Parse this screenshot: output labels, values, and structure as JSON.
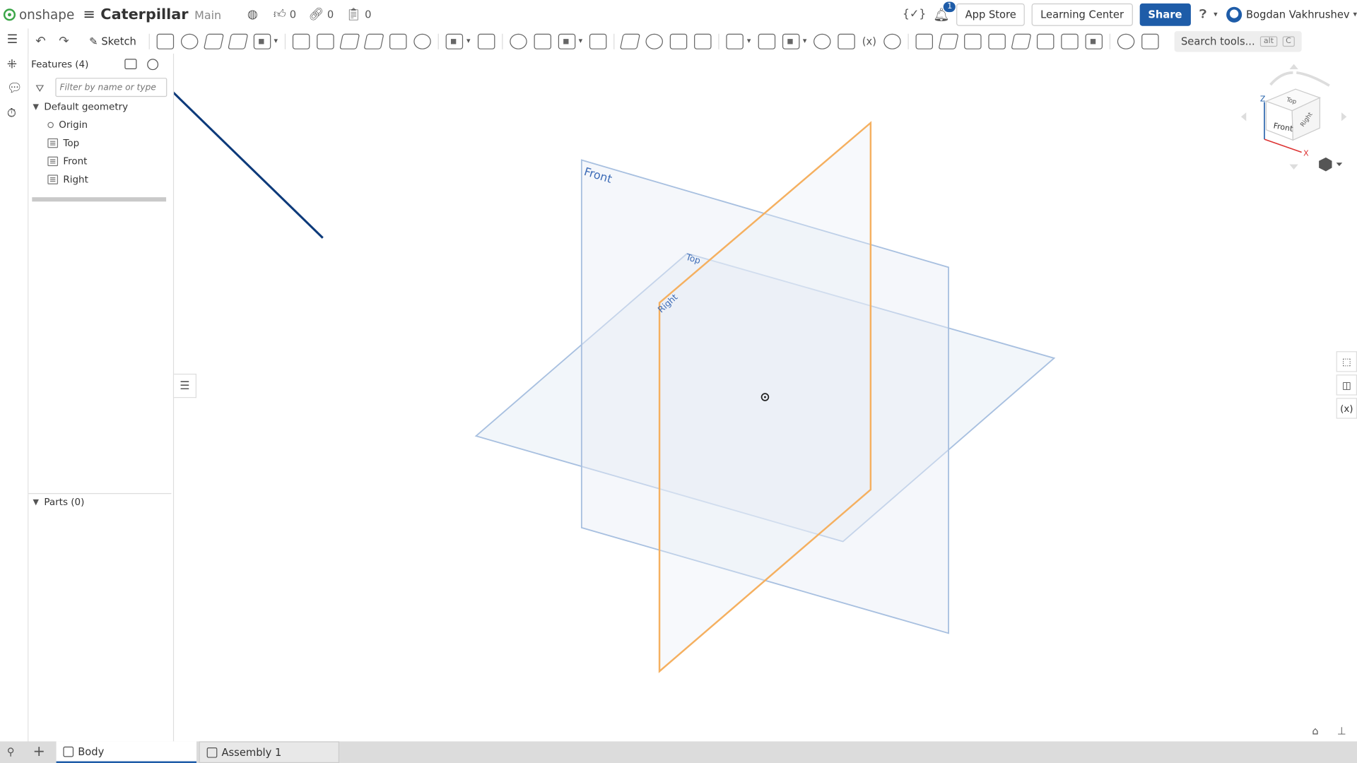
{
  "app": {
    "name": "onshape"
  },
  "document": {
    "title": "Caterpillar",
    "branch": "Main"
  },
  "topbar": {
    "likes": "0",
    "links": "0",
    "copies": "0",
    "notifications": "1",
    "app_store": "App Store",
    "learning_center": "Learning Center",
    "share": "Share",
    "user": "Bogdan Vakhrushev"
  },
  "toolbar": {
    "sketch_label": "Sketch",
    "search_label": "Search tools...",
    "search_shortcut_1": "alt",
    "search_shortcut_2": "C"
  },
  "features": {
    "header": "Features (4)",
    "filter_placeholder": "Filter by name or type",
    "group_label": "Default geometry",
    "items": [
      {
        "label": "Origin",
        "icon": "origin-icon"
      },
      {
        "label": "Top",
        "icon": "plane-icon"
      },
      {
        "label": "Front",
        "icon": "plane-icon"
      },
      {
        "label": "Right",
        "icon": "plane-icon"
      }
    ],
    "parts_label": "Parts (0)"
  },
  "viewport": {
    "plane_labels": {
      "front": "Front",
      "top": "Top",
      "right": "Right"
    },
    "colors": {
      "plane_stroke": "#a8c0e0",
      "plane_fill": "#e8eef6",
      "right_plane_stroke": "#f5b060",
      "label": "#3c6bb6",
      "arrow": "#0d3a7a"
    }
  },
  "view_cube": {
    "axis_z": "Z",
    "axis_x": "X",
    "faces": {
      "front": "Front",
      "top": "Top",
      "right": "Right"
    }
  },
  "tabs": [
    {
      "label": "Body",
      "active": true
    },
    {
      "label": "Assembly 1",
      "active": false
    }
  ]
}
